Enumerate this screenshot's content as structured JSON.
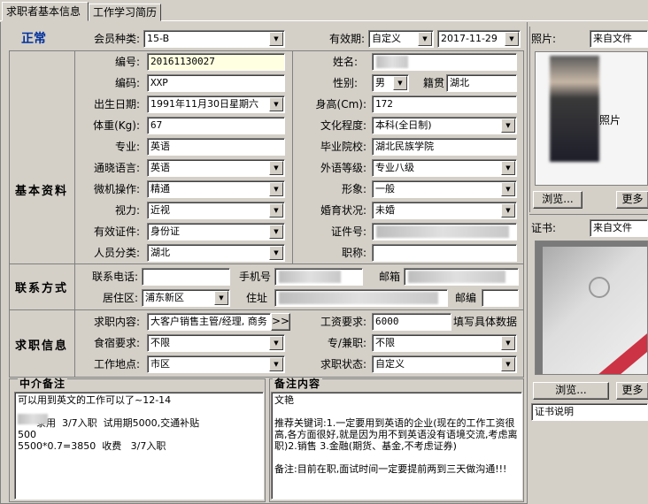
{
  "tabs": [
    "求职者基本信息",
    "工作学习简历"
  ],
  "status": "正常",
  "member_type": {
    "label": "会员种类:",
    "value": "15-B"
  },
  "validity": {
    "label": "有效期:",
    "mode": "自定义",
    "date": "2017-11-29"
  },
  "sections": {
    "basic": "基本资料",
    "contact": "联系方式",
    "job": "求职信息"
  },
  "basic": {
    "id": {
      "label": "编号:",
      "value": "20161130027"
    },
    "name": {
      "label": "姓名:",
      "value": ""
    },
    "code": {
      "label": "编码:",
      "value": "XXP"
    },
    "gender": {
      "label": "性别:",
      "value": "男"
    },
    "origin": {
      "label": "籍贯",
      "value": "湖北"
    },
    "birth": {
      "label": "出生日期:",
      "value": "1991年11月30日星期六"
    },
    "height": {
      "label": "身高(Cm):",
      "value": "172"
    },
    "weight": {
      "label": "体重(Kg):",
      "value": "67"
    },
    "education": {
      "label": "文化程度:",
      "value": "本科(全日制)"
    },
    "major": {
      "label": "专业:",
      "value": "英语"
    },
    "school": {
      "label": "毕业院校:",
      "value": "湖北民族学院"
    },
    "language": {
      "label": "通晓语言:",
      "value": "英语"
    },
    "lang_level": {
      "label": "外语等级:",
      "value": "专业八级"
    },
    "computer": {
      "label": "微机操作:",
      "value": "精通"
    },
    "appearance": {
      "label": "形象:",
      "value": "一般"
    },
    "eyesight": {
      "label": "视力:",
      "value": "近视"
    },
    "marital": {
      "label": "婚育状况:",
      "value": "未婚"
    },
    "id_doc": {
      "label": "有效证件:",
      "value": "身份证"
    },
    "id_no": {
      "label": "证件号:",
      "value": ""
    },
    "category": {
      "label": "人员分类:",
      "value": "湖北"
    },
    "title": {
      "label": "职称:",
      "value": ""
    }
  },
  "contact": {
    "phone": {
      "label": "联系电话:",
      "value": ""
    },
    "mobile": {
      "label": "手机号",
      "value": ""
    },
    "email": {
      "label": "邮箱",
      "value": ""
    },
    "district": {
      "label": "居住区:",
      "value": "浦东新区"
    },
    "address": {
      "label": "住址",
      "value": ""
    },
    "zip": {
      "label": "邮编",
      "value": ""
    }
  },
  "job": {
    "content": {
      "label": "求职内容:",
      "value": "大客户销售主管/经理, 商务"
    },
    "more_btn": ">>",
    "salary": {
      "label": "工资要求:",
      "value": "6000",
      "hint": "填写具体数据"
    },
    "lodging": {
      "label": "食宿要求:",
      "value": "不限"
    },
    "fulltime": {
      "label": "专/兼职:",
      "value": "不限"
    },
    "location": {
      "label": "工作地点:",
      "value": "市区"
    },
    "job_status": {
      "label": "求职状态:",
      "value": "自定义"
    }
  },
  "notes": {
    "agency_title": "中介备注",
    "agency_text": "可以用到英文的工作可以了~12-14\n\n      录用  3/7入职  试用期5000,交通补贴\n500\n5500*0.7=3850  收费   3/7入职",
    "remark_title": "备注内容",
    "remark_text": "文艳\n\n推荐关键词:1.一定要用到英语的企业(现在的工作工资很高,各方面很好,就是因为用不到英语没有语境交流,考虑离职)2.销售 3.金融(期货、基金,不考虑证券)\n\n备注:目前在职,面试时间一定要提前两到三天做沟通!!!"
  },
  "photo": {
    "label": "照片:",
    "source": "来自文件",
    "caption": "照片",
    "browse": "浏览...",
    "more": "更多"
  },
  "certificate": {
    "label": "证书:",
    "source": "来自文件",
    "browse": "浏览...",
    "more": "更多",
    "desc": "证书说明"
  }
}
